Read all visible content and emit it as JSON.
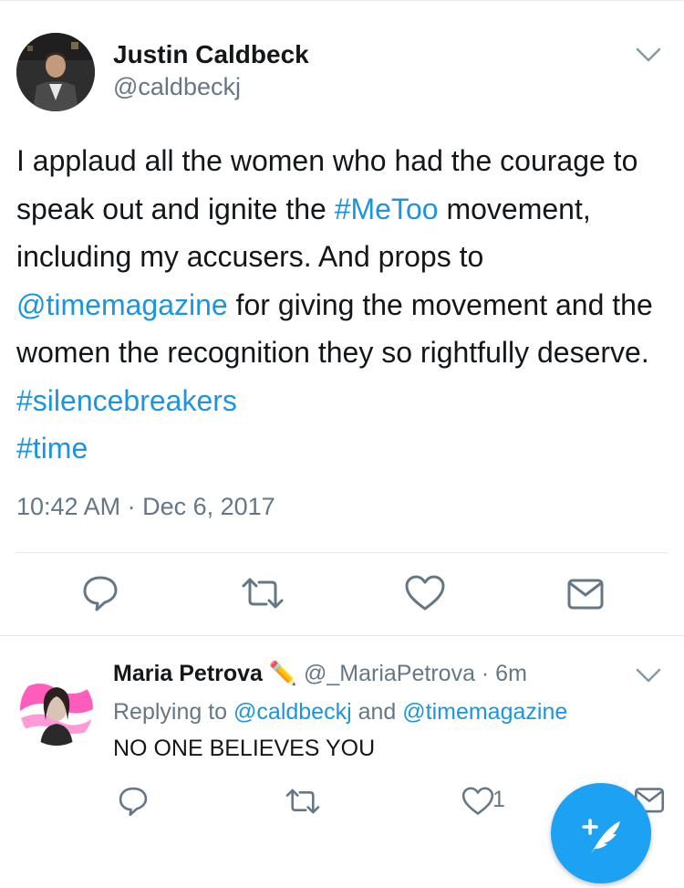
{
  "tweet": {
    "author_name": "Justin Caldbeck",
    "author_handle": "@caldbeckj",
    "text_parts": {
      "p1": "I applaud all the women who had the courage to speak out and ignite the ",
      "hashtag_metoo": "#MeToo",
      "p2": " movement, including my accusers. And props to ",
      "mention_time": "@timemagazine",
      "p3": " for giving the movement and the women the recognition they so rightfully deserve. ",
      "hashtag_silence": "#silencebreakers",
      "hashtag_time": "#time"
    },
    "timestamp": "10:42 AM · Dec 6, 2017",
    "actions": [
      "reply-icon",
      "retweet-icon",
      "like-icon",
      "share-icon"
    ]
  },
  "reply": {
    "name": "Maria Petrova",
    "emoji": "✏️",
    "handle_time": "@_MariaPetrova · 6m",
    "replying_prefix": "Replying to ",
    "replying_user1": "@caldbeckj",
    "replying_and": " and ",
    "replying_user2": "@timemagazine",
    "text": "NO ONE BELIEVES YOU",
    "like_count": "1"
  },
  "colors": {
    "link": "#1b95e0",
    "secondary_text": "#657786",
    "icon": "#657786",
    "fab": "#1da1f2",
    "divider": "#e1e8ed"
  }
}
